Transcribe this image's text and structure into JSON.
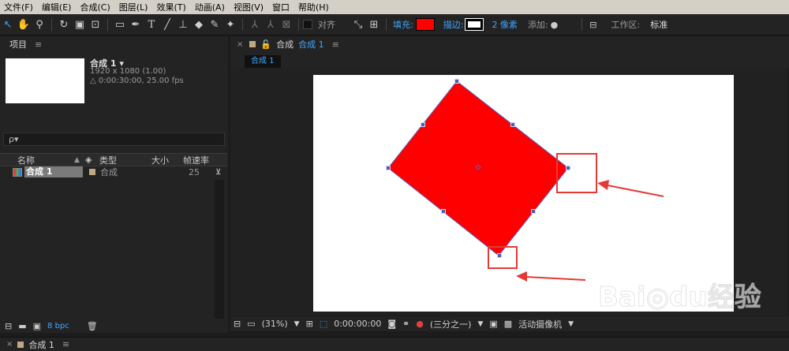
{
  "menu": [
    "文件(F)",
    "编辑(E)",
    "合成(C)",
    "图层(L)",
    "效果(T)",
    "动画(A)",
    "视图(V)",
    "窗口",
    "帮助(H)"
  ],
  "toolbar": {
    "snap_label": "对齐",
    "fill_label": "填充:",
    "fill_color": "#ff0000",
    "stroke_label": "描边:",
    "stroke_width": "2 像素",
    "add_label": "添加:",
    "workspace_label": "工作区:",
    "workspace_value": "标准"
  },
  "project": {
    "tab_label": "项目",
    "comp_name": "合成 1 ▾",
    "resolution": "1920 x 1080 (1.00)",
    "duration": "△ 0:00:30:00, 25.00 fps",
    "search_placeholder": "ρ▾",
    "columns": [
      "名称",
      "类型",
      "大小",
      "帧速率"
    ],
    "rows": [
      {
        "name": "合成 1",
        "type": "合成",
        "size": "",
        "fps": "25"
      }
    ],
    "bpc": "8 bpc"
  },
  "composition": {
    "tab_prefix": "合成",
    "tab_name": "合成 1",
    "subtab": "合成 1",
    "shape_color": "#ff0000",
    "annotation_color": "#e53935"
  },
  "viewbar": {
    "zoom": "(31%)",
    "timecode": "0:00:00:00",
    "resolution": "(三分之一)",
    "camera": "活动摄像机"
  },
  "timeline": {
    "tab_name": "合成 1"
  }
}
